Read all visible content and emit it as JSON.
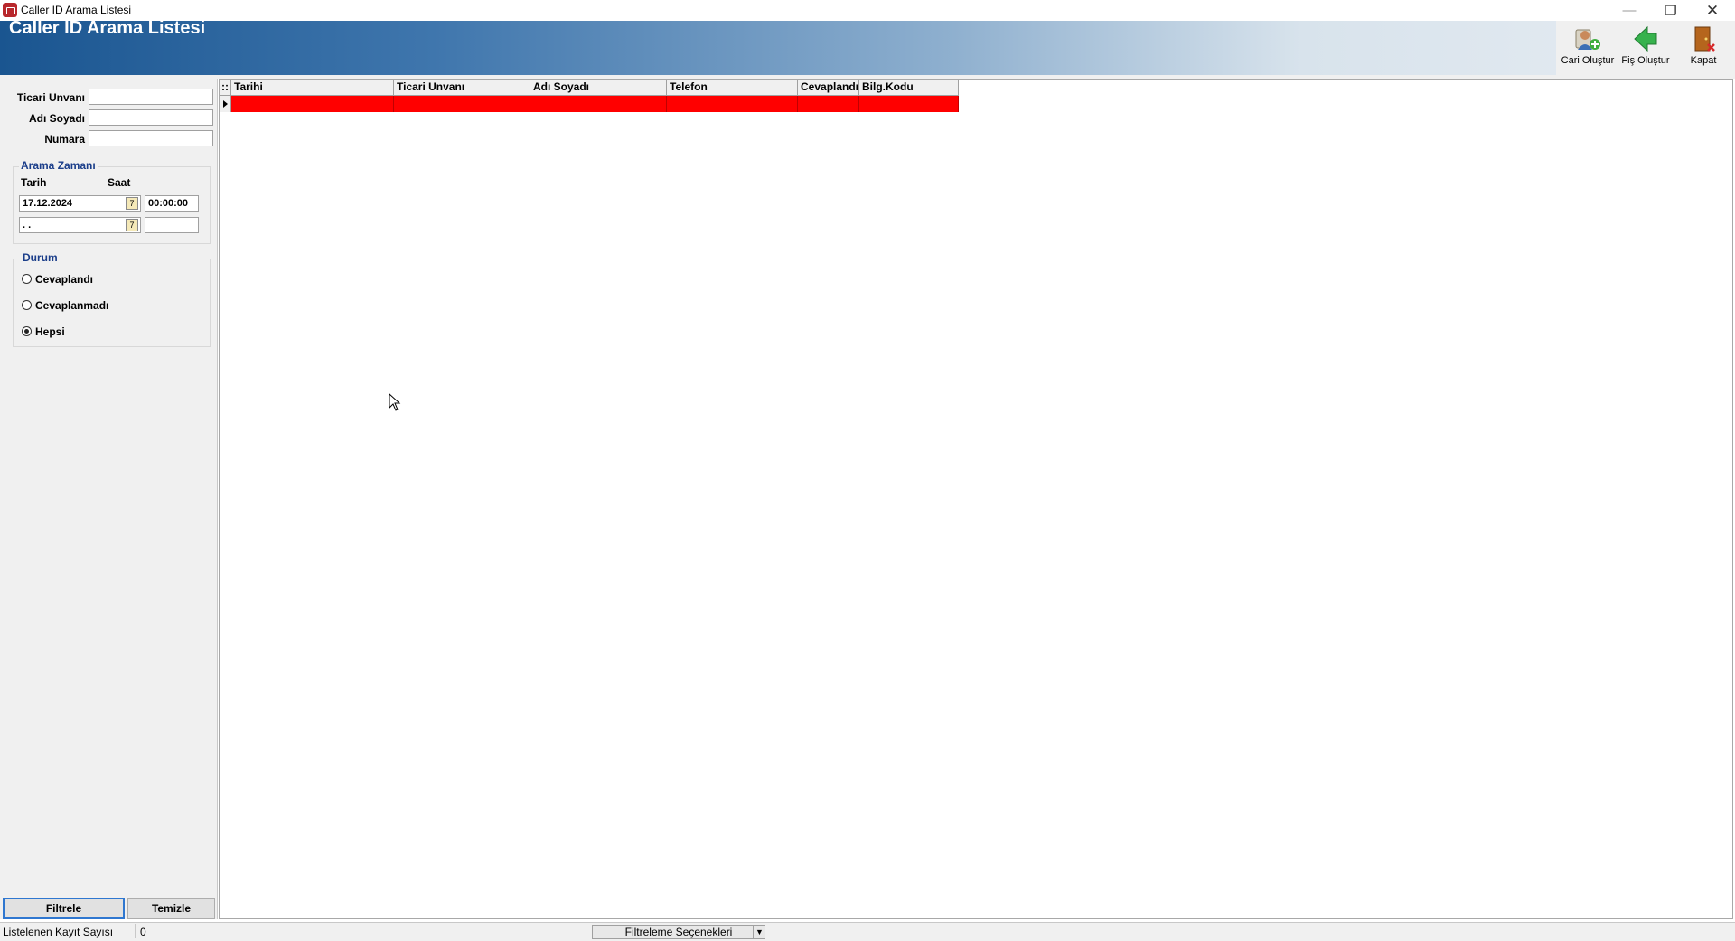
{
  "window": {
    "title": "Caller ID Arama Listesi"
  },
  "header": {
    "title": "Caller ID Arama Listesi"
  },
  "toolbar": {
    "cari_label": "Cari Oluştur",
    "fis_label": "Fiş Oluştur",
    "kapat_label": "Kapat"
  },
  "filters": {
    "ticari_label": "Ticari Unvanı",
    "adi_label": "Adı Soyadı",
    "numara_label": "Numara",
    "ticari_value": "",
    "adi_value": "",
    "numara_value": ""
  },
  "arama": {
    "title": "Arama Zamanı",
    "tarih_label": "Tarih",
    "saat_label": "Saat",
    "date1": "17.12.2024",
    "time1": "00:00:00",
    "date2": " . .",
    "time2": "",
    "cal_glyph": "7"
  },
  "durum": {
    "title": "Durum",
    "options": [
      "Cevaplandı",
      "Cevaplanmadı",
      "Hepsi"
    ],
    "selected": "Hepsi"
  },
  "buttons": {
    "filtrele": "Filtrele",
    "temizle": "Temizle"
  },
  "grid": {
    "indicator": "::",
    "columns": [
      "Tarihi",
      "Ticari Unvanı",
      "Adı Soyadı",
      "Telefon",
      "Cevaplandı",
      "Bilg.Kodu"
    ],
    "rows": [
      [
        "",
        "",
        "",
        "",
        "",
        ""
      ]
    ],
    "highlight_color": "#ff0000"
  },
  "status": {
    "label": "Listelenen Kayıt Sayısı",
    "count": "0",
    "filter_options": "Filtreleme Seçenekleri"
  }
}
